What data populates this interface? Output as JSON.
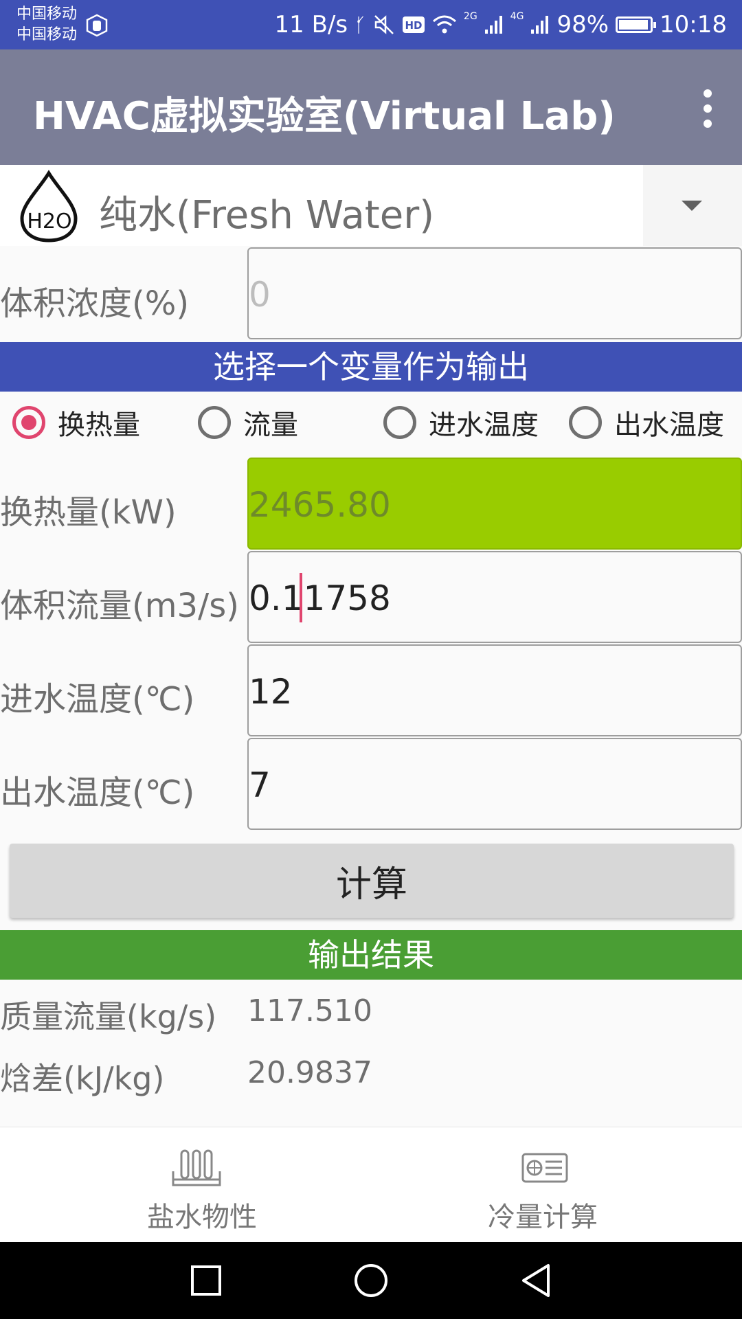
{
  "status_bar": {
    "carrier_1": "中国移动",
    "carrier_2": "中国移动",
    "net_speed": "11 B/s",
    "net_2g": "2G",
    "net_4g": "4G",
    "battery": "98%",
    "time": "10:18"
  },
  "app_bar": {
    "title": "HVAC虚拟实验室(Virtual Lab)"
  },
  "fluid_spinner": {
    "selected": "纯水(Fresh Water)",
    "icon_text": "H2O"
  },
  "concentration": {
    "label": "体积浓度(%)",
    "placeholder": "0"
  },
  "output_section": {
    "title": "选择一个变量作为输出",
    "options": [
      "换热量",
      "流量",
      "进水温度",
      "出水温度"
    ],
    "selected": "换热量"
  },
  "fields": {
    "heat": {
      "label": "换热量(kW)",
      "value": "2465.80"
    },
    "flow": {
      "label": "体积流量(m3/s)",
      "value": "0.11758"
    },
    "inlet": {
      "label": "进水温度(℃)",
      "value": "12"
    },
    "outlet": {
      "label": "出水温度(℃)",
      "value": "7"
    }
  },
  "calculate_button": "计算",
  "results": {
    "title": "输出结果",
    "mass_flow": {
      "label": "质量流量(kg/s)",
      "value": "117.510"
    },
    "enthalpy": {
      "label": "焓差(kJ/kg)",
      "value": "20.9837"
    }
  },
  "bottom_nav": {
    "items": [
      {
        "label": "盐水物性",
        "icon": "test-tubes-icon"
      },
      {
        "label": "冷量计算",
        "icon": "air-conditioner-icon"
      }
    ]
  },
  "colors": {
    "status_bar": "#3F51B5",
    "app_bar": "#7B7E97",
    "section_blue": "#3F51B5",
    "section_green": "#4A9E34",
    "highlight_field": "#99CC00",
    "radio_accent": "#E0456E"
  }
}
